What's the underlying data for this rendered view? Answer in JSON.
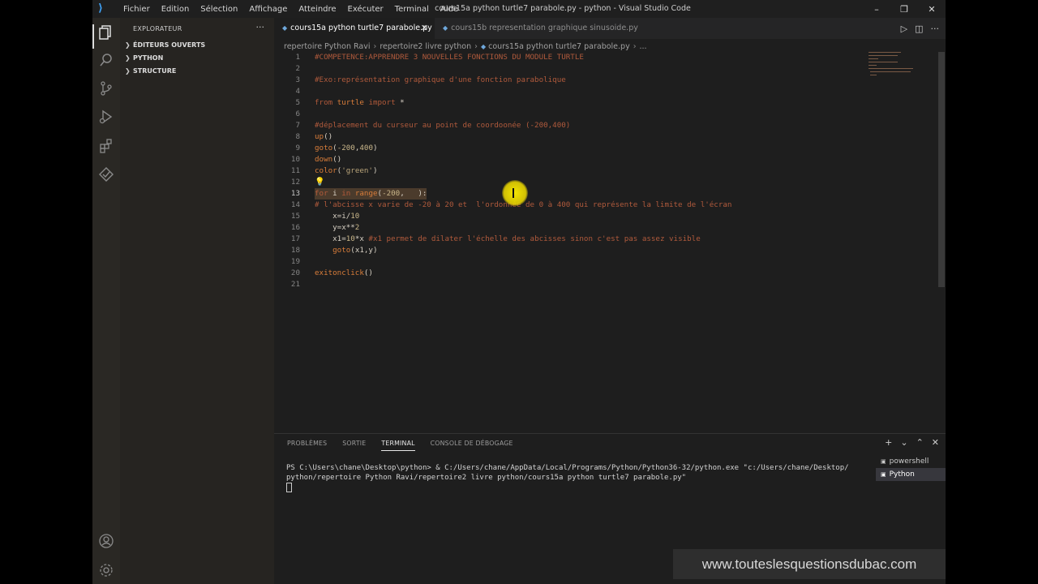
{
  "titlebar": {
    "menu": [
      "Fichier",
      "Edition",
      "Sélection",
      "Affichage",
      "Atteindre",
      "Exécuter",
      "Terminal",
      "Aide"
    ],
    "title": "cours15a python turtle7 parabole.py - python - Visual Studio Code",
    "minimize": "–",
    "restore": "❐",
    "close": "✕"
  },
  "activity_icons": [
    "explorer-icon",
    "search-icon",
    "source-control-icon",
    "run-debug-icon",
    "extensions-icon",
    "test-icon",
    "account-icon",
    "settings-gear-icon"
  ],
  "sidebar": {
    "title": "EXPLORATEUR",
    "more": "···",
    "sections": [
      "ÉDITEURS OUVERTS",
      "PYTHON",
      "STRUCTURE"
    ]
  },
  "tabs": [
    {
      "label": "cours15a python turtle7 parabole.py",
      "active": true
    },
    {
      "label": "cours15b representation graphique sinusoide.py",
      "active": false
    }
  ],
  "breadcrumb": [
    "repertoire Python Ravi",
    "repertoire2 livre python",
    "cours15a python turtle7 parabole.py",
    "..."
  ],
  "editor": {
    "current_line": 13,
    "lines": [
      "#COMPETENCE:APPRENDRE 3 NOUVELLES FONCTIONS DU MODULE TURTLE",
      "",
      "#Exo:représentation graphique d'une fonction parabolique",
      "",
      "from turtle import *",
      "",
      "#déplacement du curseur au point de coordoonée (-200,400)",
      "up()",
      "goto(-200,400)",
      "down()",
      "color('green')",
      "",
      "for i in range(-200,   ):",
      "# l'abcisse x varie de -20 à 20 et  l'ordonnée de 0 à 400 qui représente la limite de l'écran",
      "    x=i/10",
      "    y=x**2",
      "    x1=10*x #x1 permet de dilater l'échelle des abcisses sinon c'est pas assez visible",
      "    goto(x1,y)",
      "",
      "exitonclick()",
      ""
    ]
  },
  "panel": {
    "tabs": [
      "PROBLÈMES",
      "SORTIE",
      "TERMINAL",
      "CONSOLE DE DÉBOGAGE"
    ],
    "active_tab": "TERMINAL",
    "terminal_lines": [
      "PS C:\\Users\\chane\\Desktop\\python> & C:/Users/chane/AppData/Local/Programs/Python/Python36-32/python.exe \"c:/Users/chane/Desktop/",
      "python/repertoire Python Ravi/repertoire2 livre python/cours15a python turtle7 parabole.py\""
    ],
    "shells": [
      "powershell",
      "Python"
    ],
    "active_shell": "Python"
  },
  "watermark": "www.touteslesquestionsdubac.com",
  "colors": {
    "accent": "#3fa2f7",
    "comment": "#b05a3c",
    "cursor_highlight": "#f0dc00"
  }
}
